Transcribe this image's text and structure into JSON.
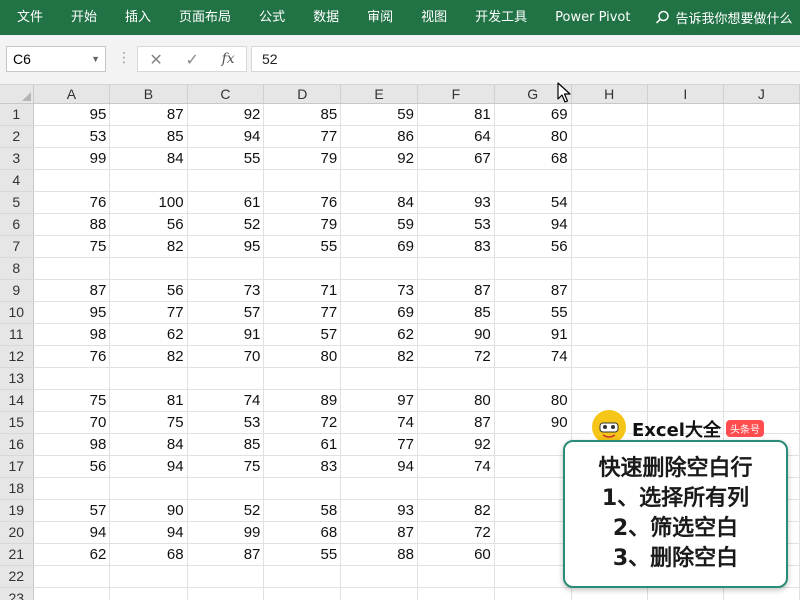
{
  "ribbon": {
    "tabs": [
      "文件",
      "开始",
      "插入",
      "页面布局",
      "公式",
      "数据",
      "审阅",
      "视图",
      "开发工具",
      "Power Pivot"
    ],
    "tell_me": "告诉我你想要做什么",
    "background_color": "#217346"
  },
  "formula_bar": {
    "name_box": "C6",
    "formula_value": "52",
    "cancel_glyph": "✕",
    "enter_glyph": "✓",
    "fx_glyph": "fx"
  },
  "sheet": {
    "columns": [
      "A",
      "B",
      "C",
      "D",
      "E",
      "F",
      "G",
      "H",
      "I",
      "J"
    ],
    "rows": [
      {
        "n": "1",
        "cells": [
          "95",
          "87",
          "92",
          "85",
          "59",
          "81",
          "69",
          "",
          "",
          ""
        ]
      },
      {
        "n": "2",
        "cells": [
          "53",
          "85",
          "94",
          "77",
          "86",
          "64",
          "80",
          "",
          "",
          ""
        ]
      },
      {
        "n": "3",
        "cells": [
          "99",
          "84",
          "55",
          "79",
          "92",
          "67",
          "68",
          "",
          "",
          ""
        ]
      },
      {
        "n": "4",
        "cells": [
          "",
          "",
          "",
          "",
          "",
          "",
          "",
          "",
          "",
          ""
        ]
      },
      {
        "n": "5",
        "cells": [
          "76",
          "100",
          "61",
          "76",
          "84",
          "93",
          "54",
          "",
          "",
          ""
        ]
      },
      {
        "n": "6",
        "cells": [
          "88",
          "56",
          "52",
          "79",
          "59",
          "53",
          "94",
          "",
          "",
          ""
        ]
      },
      {
        "n": "7",
        "cells": [
          "75",
          "82",
          "95",
          "55",
          "69",
          "83",
          "56",
          "",
          "",
          ""
        ]
      },
      {
        "n": "8",
        "cells": [
          "",
          "",
          "",
          "",
          "",
          "",
          "",
          "",
          "",
          ""
        ]
      },
      {
        "n": "9",
        "cells": [
          "87",
          "56",
          "73",
          "71",
          "73",
          "87",
          "87",
          "",
          "",
          ""
        ]
      },
      {
        "n": "10",
        "cells": [
          "95",
          "77",
          "57",
          "77",
          "69",
          "85",
          "55",
          "",
          "",
          ""
        ]
      },
      {
        "n": "11",
        "cells": [
          "98",
          "62",
          "91",
          "57",
          "62",
          "90",
          "91",
          "",
          "",
          ""
        ]
      },
      {
        "n": "12",
        "cells": [
          "76",
          "82",
          "70",
          "80",
          "82",
          "72",
          "74",
          "",
          "",
          ""
        ]
      },
      {
        "n": "13",
        "cells": [
          "",
          "",
          "",
          "",
          "",
          "",
          "",
          "",
          "",
          ""
        ]
      },
      {
        "n": "14",
        "cells": [
          "75",
          "81",
          "74",
          "89",
          "97",
          "80",
          "80",
          "",
          "",
          ""
        ]
      },
      {
        "n": "15",
        "cells": [
          "70",
          "75",
          "53",
          "72",
          "74",
          "87",
          "90",
          "",
          "",
          ""
        ]
      },
      {
        "n": "16",
        "cells": [
          "98",
          "84",
          "85",
          "61",
          "77",
          "92",
          "",
          "",
          "",
          ""
        ]
      },
      {
        "n": "17",
        "cells": [
          "56",
          "94",
          "75",
          "83",
          "94",
          "74",
          "",
          "",
          "",
          ""
        ]
      },
      {
        "n": "18",
        "cells": [
          "",
          "",
          "",
          "",
          "",
          "",
          "",
          "",
          "",
          ""
        ]
      },
      {
        "n": "19",
        "cells": [
          "57",
          "90",
          "52",
          "58",
          "93",
          "82",
          "",
          "",
          "",
          ""
        ]
      },
      {
        "n": "20",
        "cells": [
          "94",
          "94",
          "99",
          "68",
          "87",
          "72",
          "",
          "",
          "",
          ""
        ]
      },
      {
        "n": "21",
        "cells": [
          "62",
          "68",
          "87",
          "55",
          "88",
          "60",
          "",
          "",
          "",
          ""
        ]
      },
      {
        "n": "22",
        "cells": [
          "",
          "",
          "",
          "",
          "",
          "",
          "",
          "",
          "",
          ""
        ]
      },
      {
        "n": "23",
        "cells": [
          "",
          "",
          "",
          "",
          "",
          "",
          "",
          "",
          "",
          ""
        ]
      }
    ]
  },
  "watermark": {
    "name": "Excel大全",
    "tag": "头条号",
    "avatar_icon": "cartoon-avatar-icon"
  },
  "callout": {
    "lines": [
      "快速删除空白行",
      "1、选择所有列",
      "2、筛选空白",
      "3、删除空白"
    ],
    "border_color": "#2a8c78"
  }
}
